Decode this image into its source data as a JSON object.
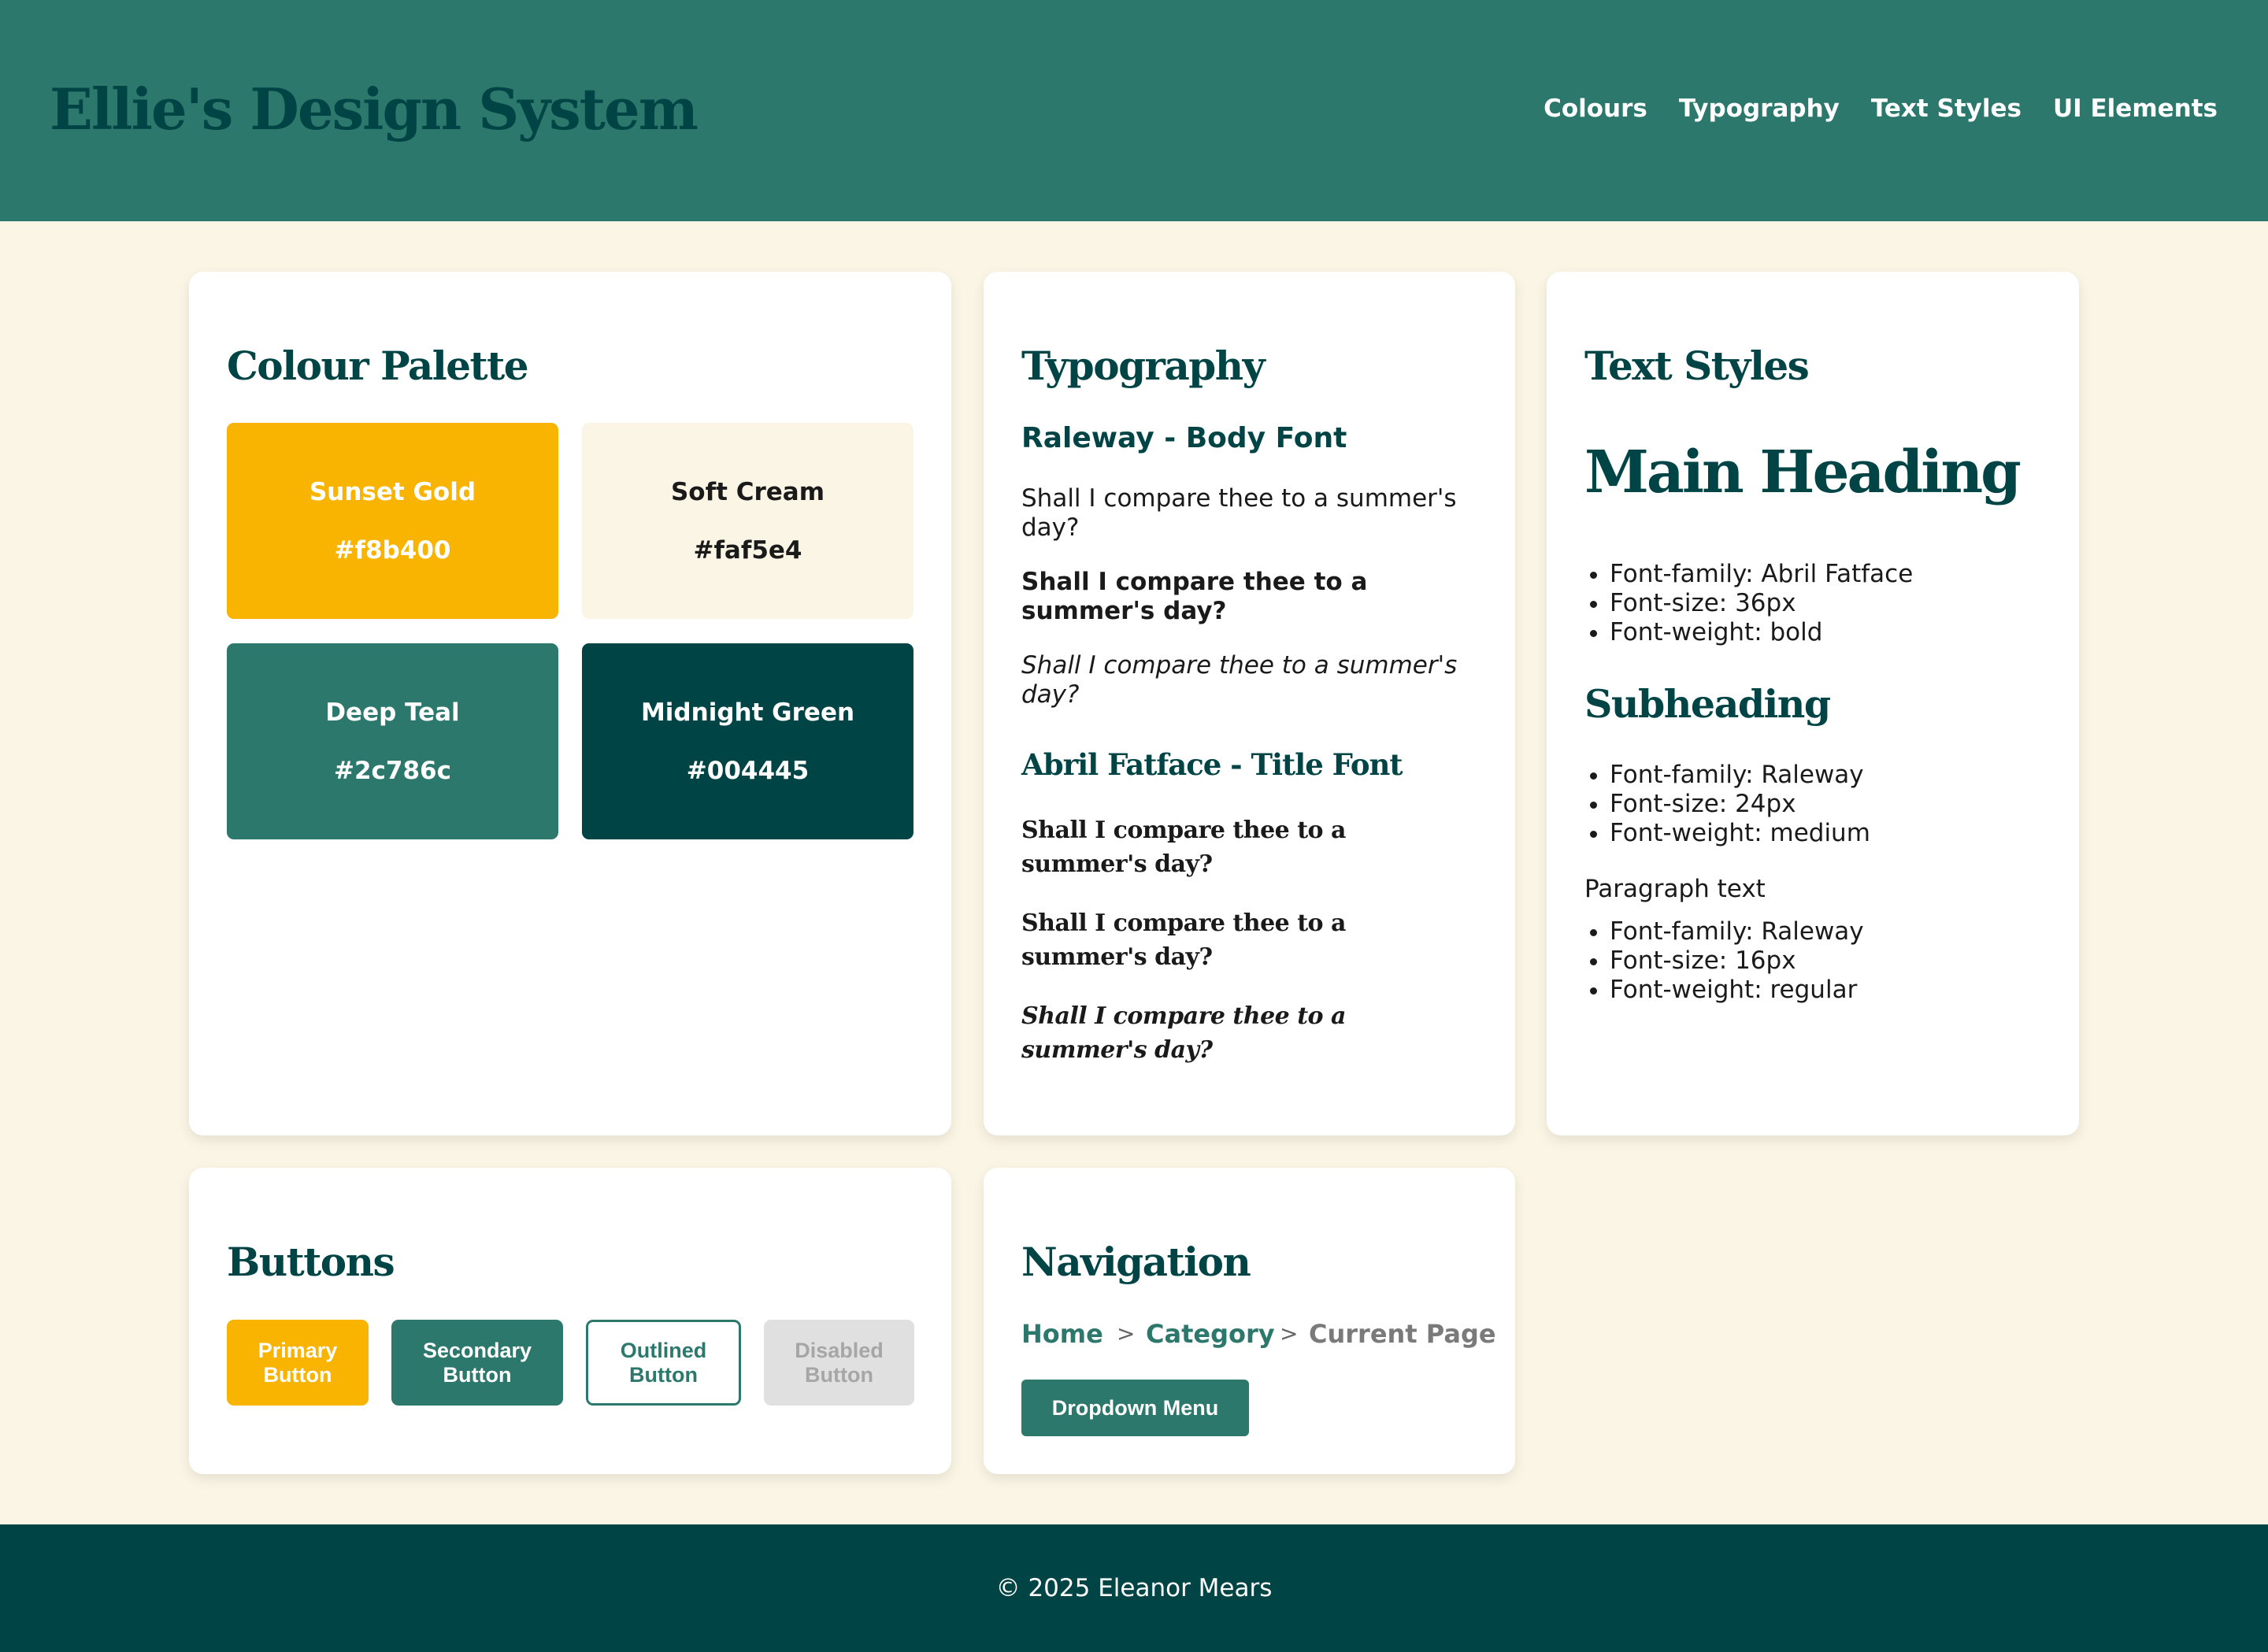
{
  "header": {
    "title": "Ellie's Design System",
    "nav": [
      "Colours",
      "Typography",
      "Text Styles",
      "UI Elements"
    ]
  },
  "colour_palette": {
    "title": "Colour Palette",
    "swatches": [
      {
        "name": "Sunset Gold",
        "hex": "#f8b400"
      },
      {
        "name": "Soft Cream",
        "hex": "#faf5e4"
      },
      {
        "name": "Deep Teal",
        "hex": "#2c786c"
      },
      {
        "name": "Midnight Green",
        "hex": "#004445"
      }
    ]
  },
  "typography": {
    "title": "Typography",
    "body_font_label": "Raleway - Body Font",
    "body_samples": [
      "Shall I compare thee to a summer's day?",
      "Shall I compare thee to a summer's day?",
      "Shall I compare thee to a summer's day?"
    ],
    "title_font_label": "Abril Fatface - Title Font",
    "title_samples": [
      "Shall I compare thee to a summer's day?",
      "Shall I compare thee to a summer's day?",
      "Shall I compare thee to a summer's day?"
    ]
  },
  "text_styles": {
    "title": "Text Styles",
    "main_heading": "Main Heading",
    "main_heading_specs": [
      "Font-family: Abril Fatface",
      "Font-size: 36px",
      "Font-weight: bold"
    ],
    "subheading": "Subheading",
    "subheading_specs": [
      "Font-family: Raleway",
      "Font-size: 24px",
      "Font-weight: medium"
    ],
    "paragraph": "Paragraph text",
    "paragraph_specs": [
      "Font-family: Raleway",
      "Font-size: 16px",
      "Font-weight: regular"
    ]
  },
  "buttons": {
    "title": "Buttons",
    "primary": "Primary Button",
    "secondary": "Secondary Button",
    "outlined": "Outlined Button",
    "disabled": "Disabled Button"
  },
  "navigation": {
    "title": "Navigation",
    "breadcrumb": [
      "Home",
      "Category",
      "Current Page"
    ],
    "separator": ">",
    "dropdown": "Dropdown Menu"
  },
  "footer": {
    "text": "© 2025 Eleanor Mears"
  },
  "colors": {
    "header_bg": "#2c786c",
    "footer_bg": "#004445",
    "page_bg": "#faf5e4",
    "accent": "#f8b400"
  }
}
